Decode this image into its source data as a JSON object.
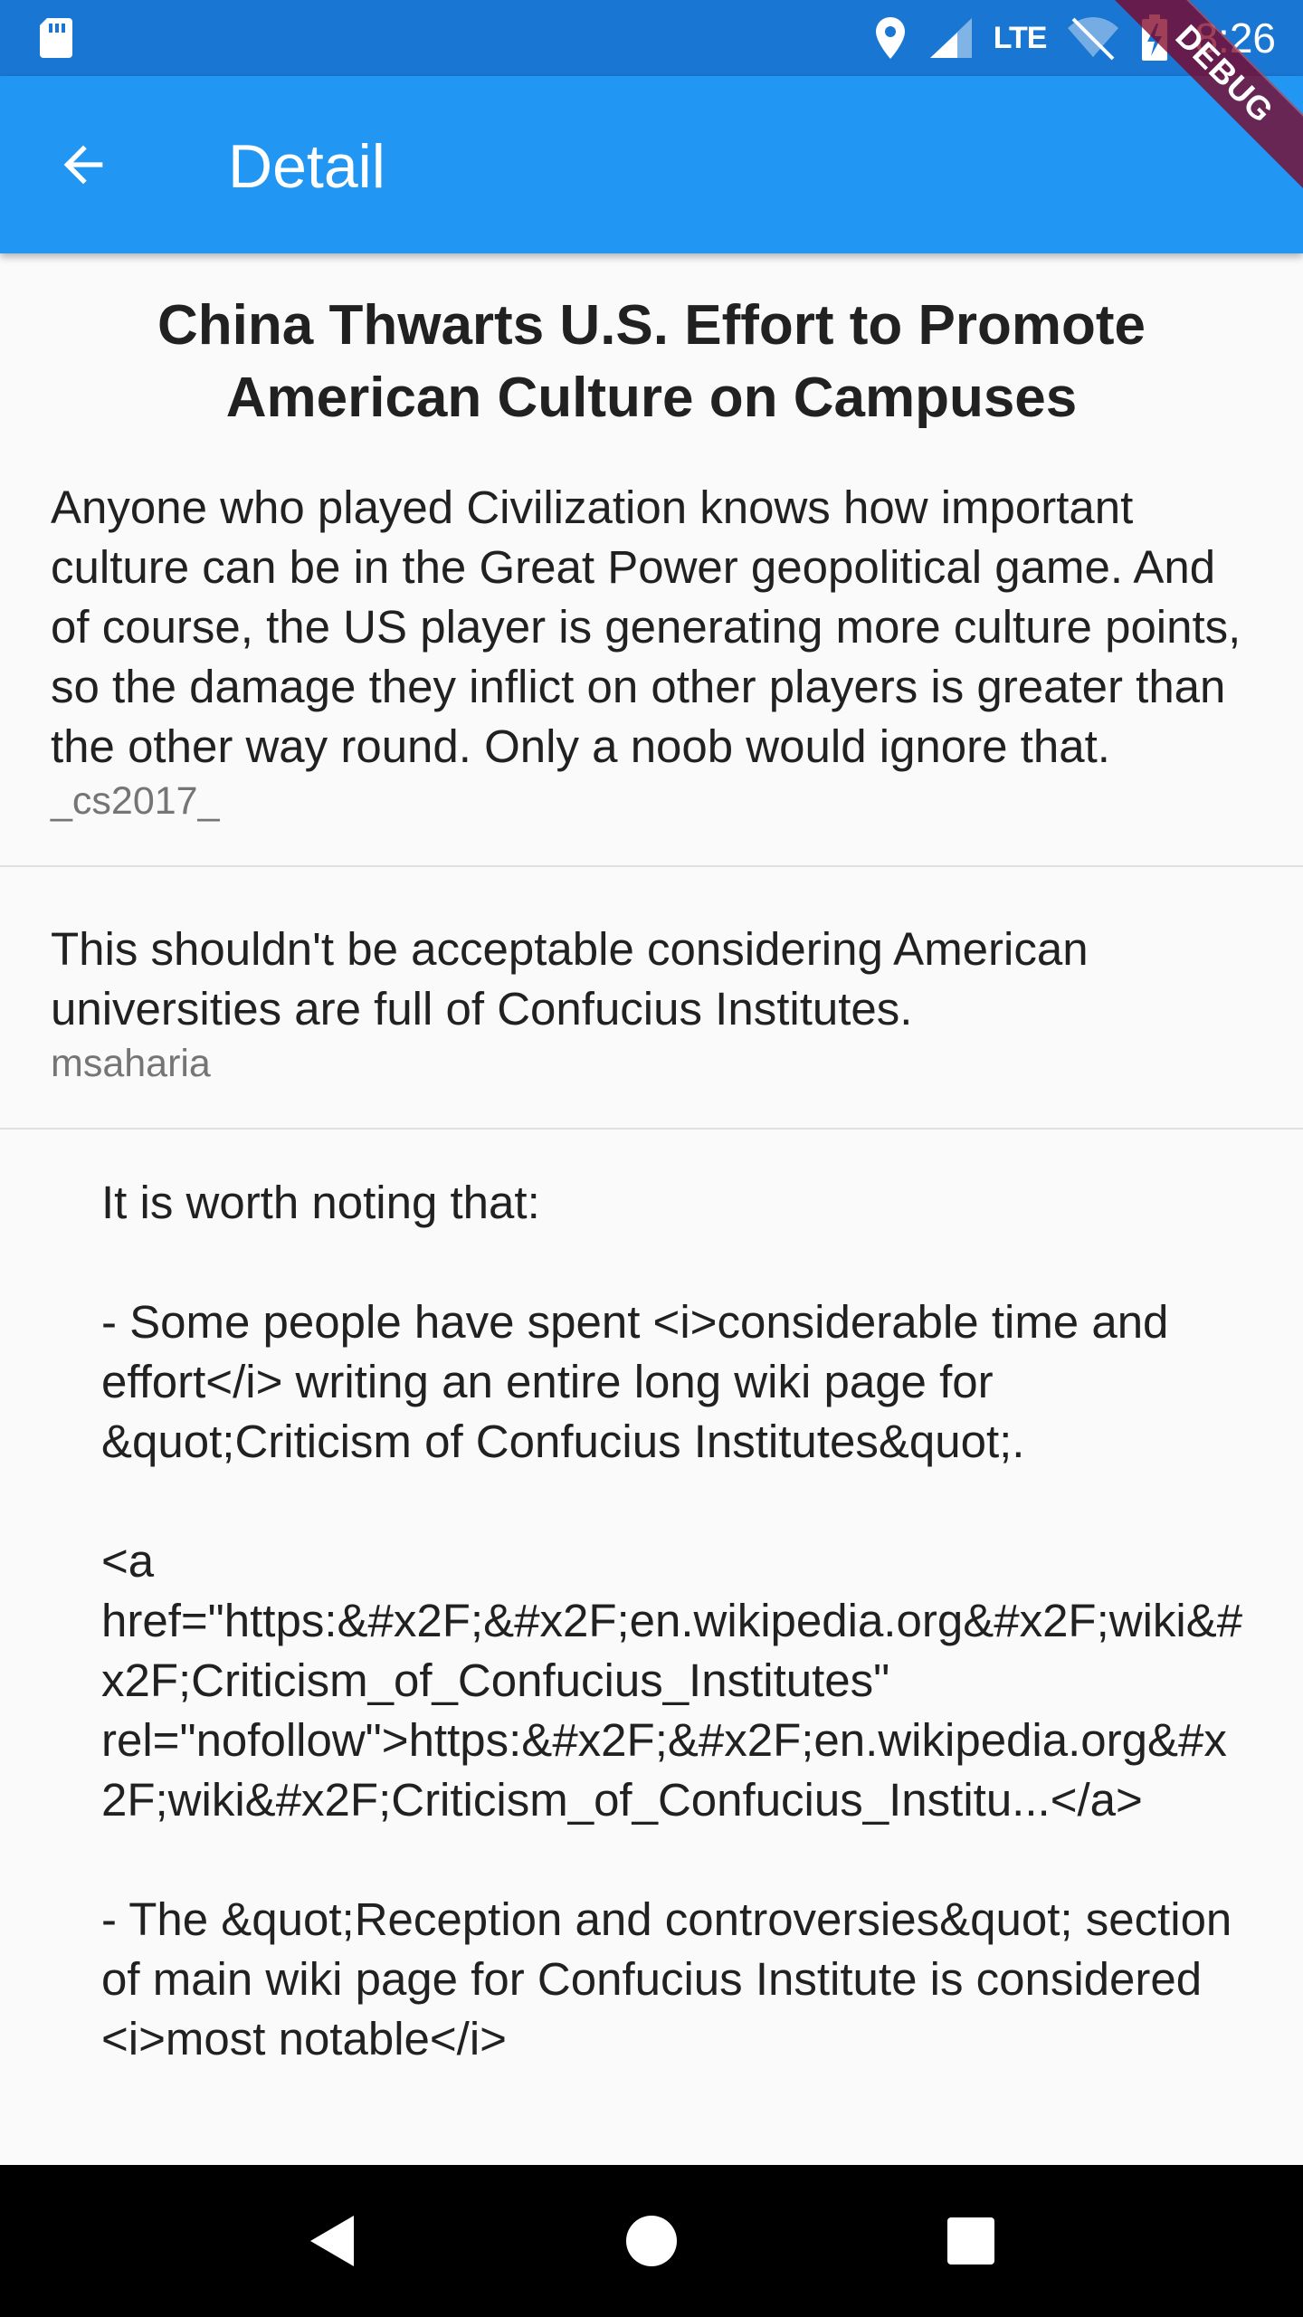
{
  "status_bar": {
    "time": "8:26",
    "network": "LTE",
    "icons": [
      "sd-card-icon",
      "location-icon",
      "cell-signal-icon",
      "wifi-off-icon",
      "battery-charging-icon"
    ]
  },
  "app_bar": {
    "title": "Detail",
    "back_icon": "arrow-back-icon"
  },
  "debug_banner": {
    "label": "DEBUG"
  },
  "article": {
    "title": "China Thwarts U.S. Effort to Promote American Culture on Campuses"
  },
  "comments": [
    {
      "text": "Anyone who played Civilization knows how important culture can be in the Great Power geopolitical game. And of course, the US player is generating more culture points, so the damage they inflict on other players is greater than the other way round. Only a noob would ignore that.",
      "author": "_cs2017_"
    },
    {
      "text": "This shouldn't be acceptable considering American universities are full of Confucius Institutes.",
      "author": "msaharia"
    },
    {
      "text": "It is worth noting that:\n\n- Some people have spent <i>considerable time and effort</i> writing an entire long wiki page for &quot;Criticism of Confucius Institutes&quot;.\n\n<a href=\"https:&#x2F;&#x2F;en.wikipedia.org&#x2F;wiki&#x2F;Criticism_of_Confucius_Institutes\" rel=\"nofollow\">https:&#x2F;&#x2F;en.wikipedia.org&#x2F;wiki&#x2F;Criticism_of_Confucius_Institu...</a>\n\n- The &quot;Reception and controversies&quot; section of main wiki page for Confucius Institute is considered <i>most notable</i>",
      "author": ""
    }
  ],
  "nav_bar": {
    "icons": [
      "back-triangle-icon",
      "home-circle-icon",
      "recents-square-icon"
    ]
  },
  "colors": {
    "status_bar": "#1976D2",
    "app_bar": "#2196F3",
    "background": "#FAFAFA",
    "author_text": "#757575",
    "divider": "#E0E0E0",
    "debug_banner": "#800020"
  }
}
